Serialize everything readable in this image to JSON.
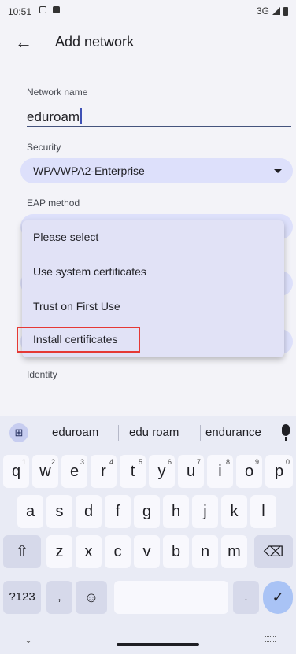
{
  "status_bar": {
    "time": "10:51",
    "network": "3G"
  },
  "app_bar": {
    "title": "Add network"
  },
  "form": {
    "network_name_label": "Network name",
    "network_name_value": "eduroam",
    "security_label": "Security",
    "security_value": "WPA/WPA2-Enterprise",
    "eap_label": "EAP method",
    "identity_label": "Identity"
  },
  "dropdown_menu": {
    "items": [
      "Please select",
      "Use system certificates",
      "Trust on First Use",
      "Install certificates"
    ],
    "highlighted_item": "Install certificates"
  },
  "keyboard": {
    "suggestions": [
      "eduroam",
      "edu roam",
      "endurance"
    ],
    "row1": [
      "q",
      "w",
      "e",
      "r",
      "t",
      "y",
      "u",
      "i",
      "o",
      "p"
    ],
    "row1_hints": [
      "1",
      "2",
      "3",
      "4",
      "5",
      "6",
      "7",
      "8",
      "9",
      "0"
    ],
    "row2": [
      "a",
      "s",
      "d",
      "f",
      "g",
      "h",
      "j",
      "k",
      "l"
    ],
    "row3": [
      "z",
      "x",
      "c",
      "v",
      "b",
      "n",
      "m"
    ],
    "symbols_key": "?123",
    "comma_key": ",",
    "period_key": "."
  },
  "colors": {
    "accent_pill": "#dde0fb",
    "menu_bg": "#e1e2f6",
    "highlight_border": "#e53935",
    "enter_key": "#a9c3f5"
  }
}
